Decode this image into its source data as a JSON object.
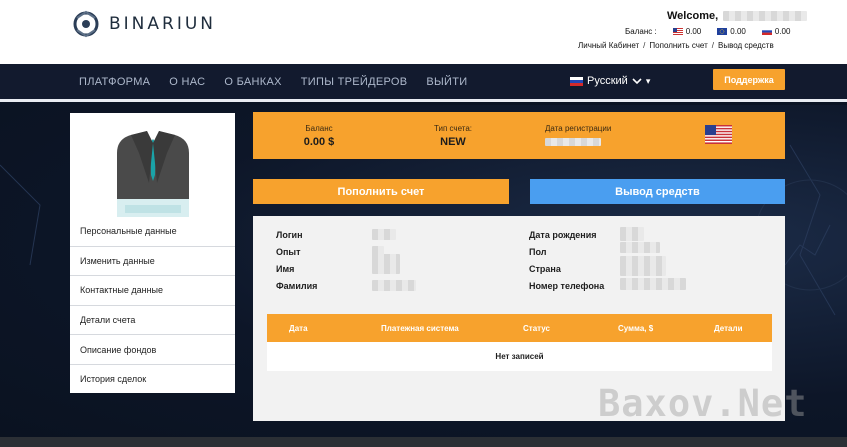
{
  "header": {
    "logo_text": "BINARIUN",
    "welcome": "Welcome,",
    "balance_label": "Баланс :",
    "balances": [
      {
        "currency": "usd-flag-icon",
        "value": "0.00"
      },
      {
        "currency": "eur-flag-icon",
        "value": "0.00"
      },
      {
        "currency": "rub-flag-icon",
        "value": "0.00"
      }
    ],
    "links": [
      "Личный Кабинет",
      "Пополнить счет",
      "Вывод средств"
    ]
  },
  "nav": {
    "items": [
      "ПЛАТФОРМА",
      "О НАС",
      "О БАНКАХ",
      "ТИПЫ ТРЕЙДЕРОВ",
      "ВЫЙТИ"
    ],
    "language": "Русский",
    "support": "Поддержка"
  },
  "sidebar": {
    "items": [
      "Персональные данные",
      "Изменить данные",
      "Контактные данные",
      "Детали счета",
      "Описание фондов",
      "История сделок"
    ]
  },
  "info": {
    "balance_label": "Баланс",
    "balance_value": "0.00 $",
    "account_type_label": "Тип счета:",
    "account_type_value": "NEW",
    "reg_date_label": "Дата регистрации"
  },
  "actions": {
    "deposit": "Пополнить счет",
    "withdraw": "Вывод средств"
  },
  "profile": {
    "left": [
      "Логин",
      "Опыт",
      "Имя",
      "Фамилия"
    ],
    "right": [
      "Дата рождения",
      "Пол",
      "Страна",
      "Номер телефона"
    ]
  },
  "transactions": {
    "columns": [
      "Дата",
      "Платежная система",
      "Статус",
      "Сумма, $",
      "Детали"
    ],
    "empty": "Нет записей"
  },
  "watermark": "Baxov.Net",
  "colors": {
    "accent_orange": "#f7a22d",
    "accent_blue": "#4a9ef0",
    "nav_bg": "#121a2e"
  }
}
